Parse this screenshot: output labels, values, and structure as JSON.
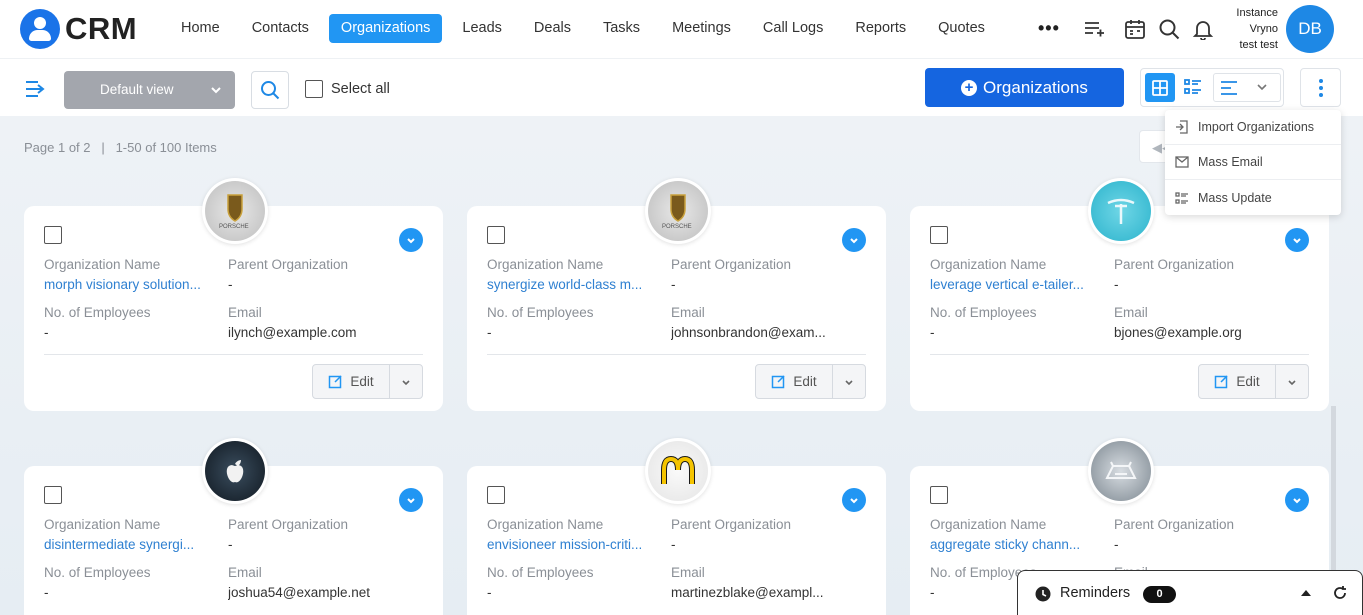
{
  "app": {
    "logo_text": "CRM"
  },
  "nav": {
    "items": [
      "Home",
      "Contacts",
      "Organizations",
      "Leads",
      "Deals",
      "Tasks",
      "Meetings",
      "Call Logs",
      "Reports",
      "Quotes"
    ],
    "active": "Organizations",
    "more": "•••"
  },
  "user": {
    "line1": "Instance",
    "line2": "Vryno",
    "line3": "test test",
    "initials": "DB"
  },
  "toolbar": {
    "view_label": "Default view",
    "select_all_label": "Select all",
    "add_label": "Organizations"
  },
  "pager": {
    "page_text": "Page 1 of 2",
    "range_text": "1-50 of 100 Items"
  },
  "menu": {
    "items": [
      "Import Organizations",
      "Mass Email",
      "Mass Update"
    ]
  },
  "labels": {
    "org_name": "Organization Name",
    "parent_org": "Parent Organization",
    "employees": "No. of Employees",
    "email": "Email",
    "edit": "Edit"
  },
  "cards": [
    {
      "logo": "porsche-logo",
      "org_name": "morph visionary solution...",
      "parent_org": "-",
      "employees": "-",
      "email": "ilynch@example.com"
    },
    {
      "logo": "porsche-logo",
      "org_name": "synergize world-class m...",
      "parent_org": "-",
      "employees": "-",
      "email": "johnsonbrandon@exam..."
    },
    {
      "logo": "tesla-logo",
      "org_name": "leverage vertical e-tailer...",
      "parent_org": "-",
      "employees": "-",
      "email": "bjones@example.org"
    },
    {
      "logo": "apple-logo",
      "org_name": "disintermediate synergi...",
      "parent_org": "-",
      "employees": "-",
      "email": "joshua54@example.net"
    },
    {
      "logo": "mcdonalds-logo",
      "org_name": "envisioneer mission-criti...",
      "parent_org": "-",
      "employees": "-",
      "email": "martinezblake@exampl..."
    },
    {
      "logo": "car-logo",
      "org_name": "aggregate sticky chann...",
      "parent_org": "-",
      "employees": "-",
      "email": ""
    }
  ],
  "reminders": {
    "label": "Reminders",
    "count": "0"
  },
  "colors": {
    "primary": "#1565e0",
    "accent": "#2196f3",
    "link": "#2f80d1",
    "muted": "#8a8f96"
  }
}
